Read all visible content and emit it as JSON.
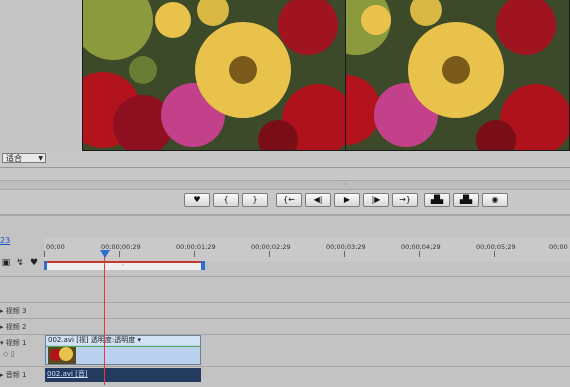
{
  "monitor": {
    "zoom_select": "适合",
    "scrub_marker": "◦"
  },
  "transport": {
    "buttons": [
      {
        "icon": "marker-icon",
        "glyph": "♥"
      },
      {
        "icon": "set-in-icon",
        "glyph": "{"
      },
      {
        "icon": "set-out-icon",
        "glyph": "}"
      },
      {
        "icon": "go-to-in-icon",
        "glyph": "{←"
      },
      {
        "icon": "step-back-icon",
        "glyph": "◀|"
      },
      {
        "icon": "play-icon",
        "glyph": "▶"
      },
      {
        "icon": "step-forward-icon",
        "glyph": "|▶"
      },
      {
        "icon": "go-to-out-icon",
        "glyph": "→}"
      },
      {
        "icon": "lift-icon",
        "glyph": "▟▙"
      },
      {
        "icon": "extract-icon",
        "glyph": "▟▙"
      },
      {
        "icon": "export-frame-icon",
        "glyph": "◉"
      }
    ]
  },
  "timeline": {
    "timecode": "23",
    "ruler_labels": [
      "00;00",
      "00;00;00;29",
      "00;00;01;29",
      "00;00;02;29",
      "00;00;03;29",
      "00;00;04;29",
      "00;00;05;29",
      "00;00"
    ],
    "workarea_marker": "◦",
    "tracks": {
      "video3": "视频 3",
      "video2": "视频 2",
      "video1": "视频 1",
      "audio1": "音频 1"
    },
    "video_clip_label": "002.avi [视] 透明度:透明度 ▾",
    "audio_clip_label": "002.avi [音]"
  },
  "colors": {
    "playhead": "#e53935",
    "workarea_border": "#c0392b",
    "clip_video": "#b9d1ee",
    "clip_audio": "#233b5e"
  }
}
